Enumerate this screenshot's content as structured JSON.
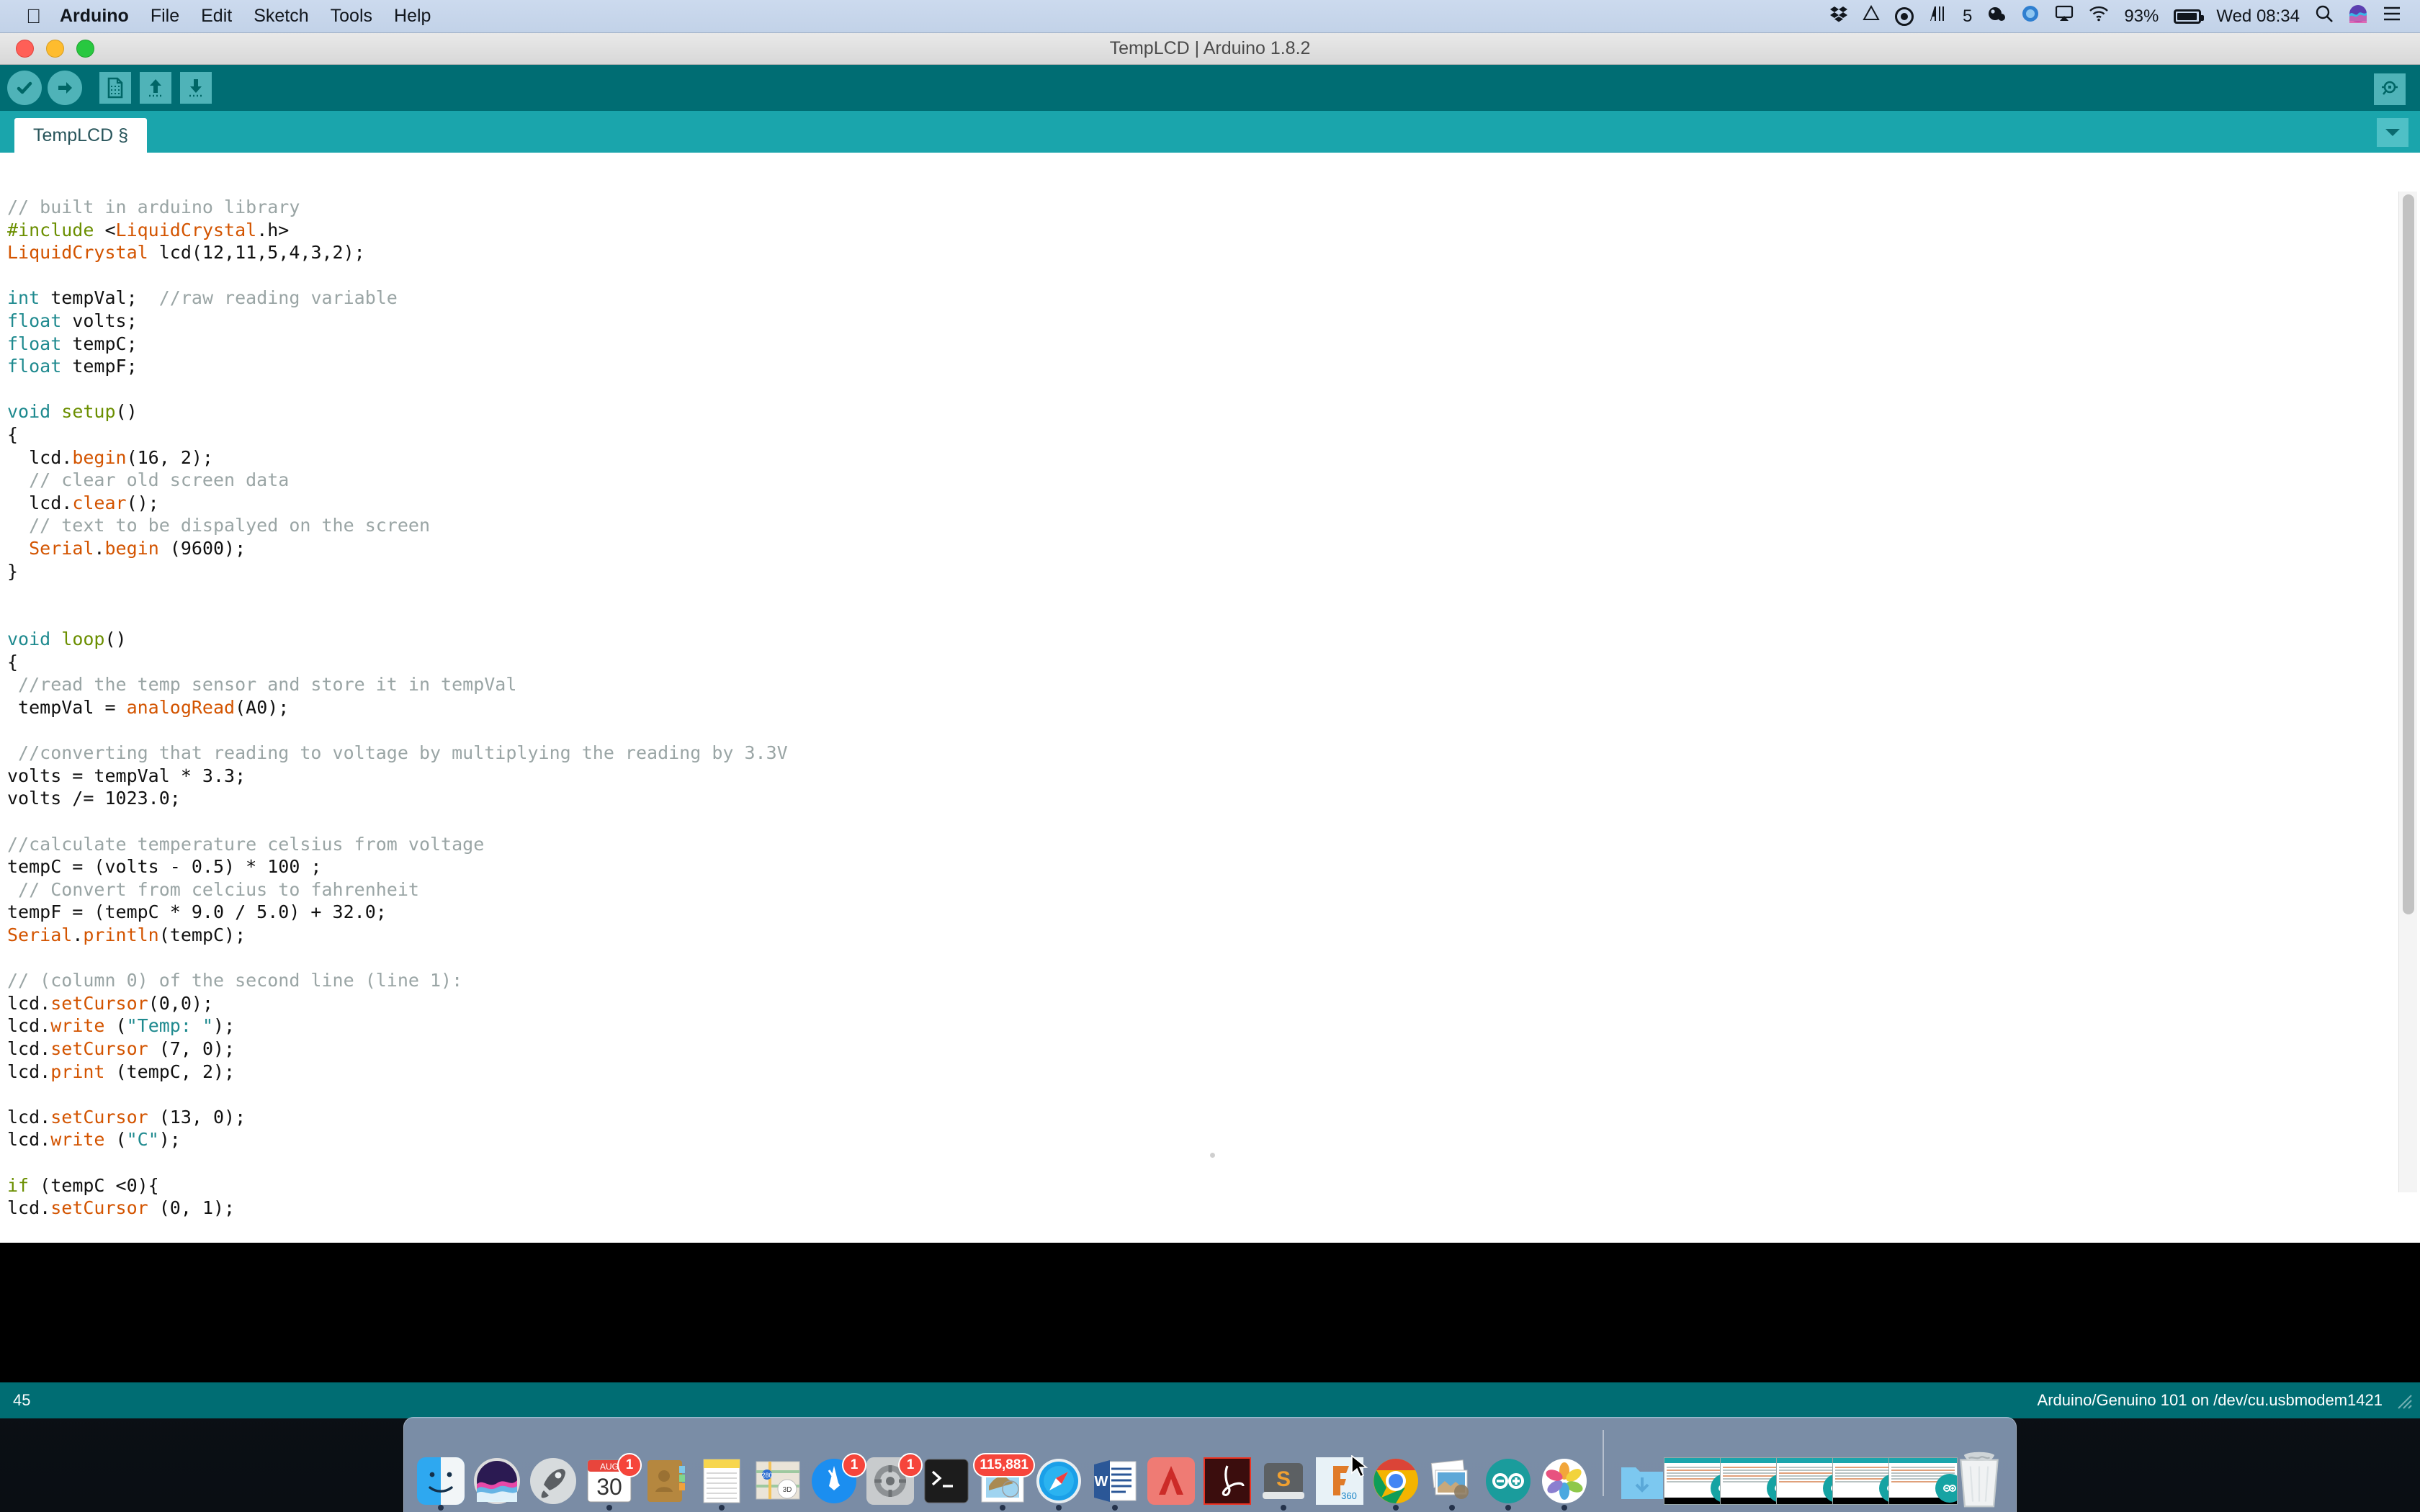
{
  "menubar": {
    "apple_icon": "apple-logo-icon",
    "items": [
      {
        "label": "Arduino",
        "bold": true
      },
      {
        "label": "File",
        "bold": false
      },
      {
        "label": "Edit",
        "bold": false
      },
      {
        "label": "Sketch",
        "bold": false
      },
      {
        "label": "Tools",
        "bold": false
      },
      {
        "label": "Help",
        "bold": false
      }
    ],
    "status": {
      "dropbox_icon": "dropbox-icon",
      "drive_icon": "google-drive-icon",
      "record_icon": "screen-record-icon",
      "soundmeter_icon": "audio-levels-icon",
      "soundmeter_value": "5",
      "backup_icon": "backup-icon",
      "shell_icon": "teamviewer-icon",
      "airplay_icon": "airplay-icon",
      "wifi_icon": "wifi-icon",
      "battery_percent": "93%",
      "battery_icon": "battery-icon",
      "clock": "Wed 08:34",
      "search_icon": "spotlight-search-icon",
      "siri_icon": "siri-icon",
      "notification_icon": "notification-center-icon"
    }
  },
  "window": {
    "title": "TempLCD | Arduino 1.8.2",
    "traffic": {
      "close": "close-button",
      "minimize": "minimize-button",
      "zoom": "zoom-button"
    }
  },
  "toolbar": {
    "verify_label": "Verify",
    "upload_label": "Upload",
    "new_label": "New",
    "open_label": "Open",
    "save_label": "Save",
    "serial_monitor_label": "Serial Monitor"
  },
  "tabs": {
    "active": "TempLCD §",
    "dropdown_icon": "chevron-down-icon"
  },
  "editor": {
    "lines": [
      [
        {
          "t": "// built in arduino library",
          "c": "cm"
        }
      ],
      [
        {
          "t": "#include ",
          "c": "pp"
        },
        {
          "t": "<",
          "c": ""
        },
        {
          "t": "LiquidCrystal",
          "c": "mth"
        },
        {
          "t": ".h>",
          "c": ""
        }
      ],
      [
        {
          "t": "LiquidCrystal",
          "c": "mth"
        },
        {
          "t": " lcd(12,11,5,4,3,2);",
          "c": ""
        }
      ],
      [
        {
          "t": "",
          "c": ""
        }
      ],
      [
        {
          "t": "int",
          "c": "kw"
        },
        {
          "t": " tempVal;  ",
          "c": ""
        },
        {
          "t": "//raw reading variable",
          "c": "cm"
        }
      ],
      [
        {
          "t": "float",
          "c": "kw"
        },
        {
          "t": " volts;",
          "c": ""
        }
      ],
      [
        {
          "t": "float",
          "c": "kw"
        },
        {
          "t": " tempC;",
          "c": ""
        }
      ],
      [
        {
          "t": "float",
          "c": "kw"
        },
        {
          "t": " tempF;",
          "c": ""
        }
      ],
      [
        {
          "t": "",
          "c": ""
        }
      ],
      [
        {
          "t": "void",
          "c": "kw"
        },
        {
          "t": " ",
          "c": ""
        },
        {
          "t": "setup",
          "c": "fn"
        },
        {
          "t": "()",
          "c": ""
        }
      ],
      [
        {
          "t": "{",
          "c": ""
        }
      ],
      [
        {
          "t": "  lcd.",
          "c": ""
        },
        {
          "t": "begin",
          "c": "mth"
        },
        {
          "t": "(16, 2);",
          "c": ""
        }
      ],
      [
        {
          "t": "  // clear old screen data",
          "c": "cm"
        }
      ],
      [
        {
          "t": "  lcd.",
          "c": ""
        },
        {
          "t": "clear",
          "c": "mth"
        },
        {
          "t": "();",
          "c": ""
        }
      ],
      [
        {
          "t": "  // text to be dispalyed on the screen",
          "c": "cm"
        }
      ],
      [
        {
          "t": "  ",
          "c": ""
        },
        {
          "t": "Serial",
          "c": "mth"
        },
        {
          "t": ".",
          "c": ""
        },
        {
          "t": "begin",
          "c": "mth"
        },
        {
          "t": " (9600);",
          "c": ""
        }
      ],
      [
        {
          "t": "}",
          "c": ""
        }
      ],
      [
        {
          "t": "",
          "c": ""
        }
      ],
      [
        {
          "t": "",
          "c": ""
        }
      ],
      [
        {
          "t": "void",
          "c": "kw"
        },
        {
          "t": " ",
          "c": ""
        },
        {
          "t": "loop",
          "c": "fn"
        },
        {
          "t": "()",
          "c": ""
        }
      ],
      [
        {
          "t": "{",
          "c": ""
        }
      ],
      [
        {
          "t": " //read the temp sensor and store it in tempVal",
          "c": "cm"
        }
      ],
      [
        {
          "t": " tempVal = ",
          "c": ""
        },
        {
          "t": "analogRead",
          "c": "mth"
        },
        {
          "t": "(A0);",
          "c": ""
        }
      ],
      [
        {
          "t": "",
          "c": ""
        }
      ],
      [
        {
          "t": " //converting that reading to voltage by multiplying the reading by 3.3V",
          "c": "cm"
        }
      ],
      [
        {
          "t": "volts = tempVal * 3.3;",
          "c": ""
        }
      ],
      [
        {
          "t": "volts /= 1023.0;",
          "c": ""
        }
      ],
      [
        {
          "t": "",
          "c": ""
        }
      ],
      [
        {
          "t": "//calculate temperature celsius from voltage",
          "c": "cm"
        }
      ],
      [
        {
          "t": "tempC = (volts - 0.5) * 100 ;",
          "c": ""
        }
      ],
      [
        {
          "t": " // Convert from celcius to fahrenheit",
          "c": "cm"
        }
      ],
      [
        {
          "t": "tempF = (tempC * 9.0 / 5.0) + 32.0;",
          "c": ""
        }
      ],
      [
        {
          "t": "Serial",
          "c": "mth"
        },
        {
          "t": ".",
          "c": ""
        },
        {
          "t": "println",
          "c": "mth"
        },
        {
          "t": "(tempC);",
          "c": ""
        }
      ],
      [
        {
          "t": "",
          "c": ""
        }
      ],
      [
        {
          "t": "// (column 0) of the second line (line 1):",
          "c": "cm"
        }
      ],
      [
        {
          "t": "lcd.",
          "c": ""
        },
        {
          "t": "setCursor",
          "c": "mth"
        },
        {
          "t": "(0,0);",
          "c": ""
        }
      ],
      [
        {
          "t": "lcd.",
          "c": ""
        },
        {
          "t": "write",
          "c": "mth"
        },
        {
          "t": " (",
          "c": ""
        },
        {
          "t": "\"Temp: \"",
          "c": "st"
        },
        {
          "t": ");",
          "c": ""
        }
      ],
      [
        {
          "t": "lcd.",
          "c": ""
        },
        {
          "t": "setCursor",
          "c": "mth"
        },
        {
          "t": " (7, 0);",
          "c": ""
        }
      ],
      [
        {
          "t": "lcd.",
          "c": ""
        },
        {
          "t": "print",
          "c": "mth"
        },
        {
          "t": " (tempC, 2);",
          "c": ""
        }
      ],
      [
        {
          "t": "",
          "c": ""
        }
      ],
      [
        {
          "t": "lcd.",
          "c": ""
        },
        {
          "t": "setCursor",
          "c": "mth"
        },
        {
          "t": " (13, 0);",
          "c": ""
        }
      ],
      [
        {
          "t": "lcd.",
          "c": ""
        },
        {
          "t": "write",
          "c": "mth"
        },
        {
          "t": " (",
          "c": ""
        },
        {
          "t": "\"C\"",
          "c": "st"
        },
        {
          "t": ");",
          "c": ""
        }
      ],
      [
        {
          "t": "",
          "c": ""
        }
      ],
      [
        {
          "t": "if",
          "c": "fn"
        },
        {
          "t": " (tempC <0){",
          "c": ""
        }
      ],
      [
        {
          "t": "lcd.",
          "c": ""
        },
        {
          "t": "setCursor",
          "c": "mth"
        },
        {
          "t": " (0, 1);",
          "c": ""
        }
      ]
    ]
  },
  "statusbar": {
    "line_number": "45",
    "board_info": "Arduino/Genuino 101 on /dev/cu.usbmodem1421"
  },
  "dock": {
    "items": [
      {
        "name": "finder",
        "label": "Finder",
        "running": true,
        "badge": ""
      },
      {
        "name": "siri",
        "label": "Siri",
        "running": false,
        "badge": ""
      },
      {
        "name": "launchpad",
        "label": "Launchpad",
        "running": false,
        "badge": ""
      },
      {
        "name": "calendar",
        "label": "Calendar",
        "running": true,
        "badge": "1",
        "month": "AUG",
        "day": "30"
      },
      {
        "name": "contacts",
        "label": "Contacts",
        "running": false,
        "badge": ""
      },
      {
        "name": "notes",
        "label": "Notes",
        "running": true,
        "badge": ""
      },
      {
        "name": "maps",
        "label": "Maps",
        "running": false,
        "badge": ""
      },
      {
        "name": "app-store",
        "label": "App Store",
        "running": false,
        "badge": "1"
      },
      {
        "name": "system-preferences",
        "label": "System Preferences",
        "running": false,
        "badge": "1"
      },
      {
        "name": "terminal",
        "label": "Terminal",
        "running": false,
        "badge": ""
      },
      {
        "name": "mail",
        "label": "Mail",
        "running": true,
        "badge": "115,881"
      },
      {
        "name": "safari",
        "label": "Safari",
        "running": true,
        "badge": ""
      },
      {
        "name": "word",
        "label": "Microsoft Word",
        "running": true,
        "badge": ""
      },
      {
        "name": "autocad",
        "label": "AutoCAD",
        "running": false,
        "badge": ""
      },
      {
        "name": "acrobat",
        "label": "Adobe Acrobat",
        "running": false,
        "badge": ""
      },
      {
        "name": "sublime-text",
        "label": "Sublime Text",
        "running": true,
        "badge": ""
      },
      {
        "name": "fusion-360",
        "label": "Fusion 360",
        "running": false,
        "badge": "",
        "sublabel": "360"
      },
      {
        "name": "chrome",
        "label": "Google Chrome",
        "running": true,
        "badge": ""
      },
      {
        "name": "preview",
        "label": "Preview",
        "running": true,
        "badge": ""
      },
      {
        "name": "arduino",
        "label": "Arduino",
        "running": true,
        "badge": ""
      },
      {
        "name": "photos",
        "label": "Photos",
        "running": true,
        "badge": ""
      }
    ],
    "downloads_label": "Downloads",
    "minimized_windows": [
      {
        "label": "Arduino window 1"
      },
      {
        "label": "Arduino window 2"
      },
      {
        "label": "Arduino window 3"
      },
      {
        "label": "Arduino window 4"
      },
      {
        "label": "Arduino window 5"
      }
    ],
    "trash_label": "Trash"
  },
  "colors": {
    "teal_dark": "#006d73",
    "teal": "#1aa5ac",
    "teal_light": "#4fb3b8",
    "badge_red": "#f6453b",
    "comment_gray": "#9aa5a5",
    "keyword_teal": "#1f8a8f",
    "method_orange": "#d35400",
    "function_olive": "#6b8f00"
  }
}
